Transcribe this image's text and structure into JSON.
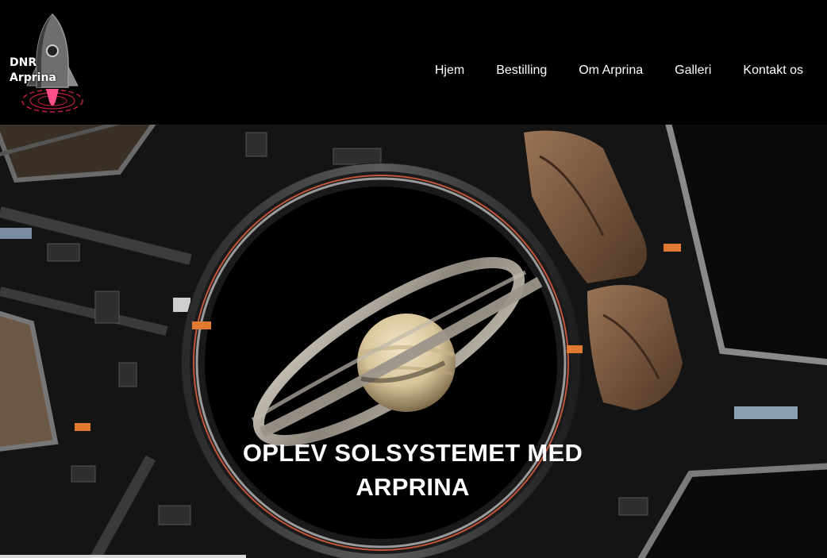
{
  "logo": {
    "line1": "DNR",
    "line2": "Arprina",
    "icon": "rocket-icon"
  },
  "nav": {
    "items": [
      {
        "label": "Hjem"
      },
      {
        "label": "Bestilling"
      },
      {
        "label": "Om Arprina"
      },
      {
        "label": "Galleri"
      },
      {
        "label": "Kontakt os"
      }
    ]
  },
  "hero": {
    "title_line1": "OPLEV SOLSYSTEMET MED",
    "title_line2": "ARPRINA",
    "image": "space-station-window-saturn"
  },
  "colors": {
    "background": "#000000",
    "nav_text": "#ffffff",
    "rocket_flame": "#ff4f8b",
    "ring_accent": "#e0304f"
  }
}
